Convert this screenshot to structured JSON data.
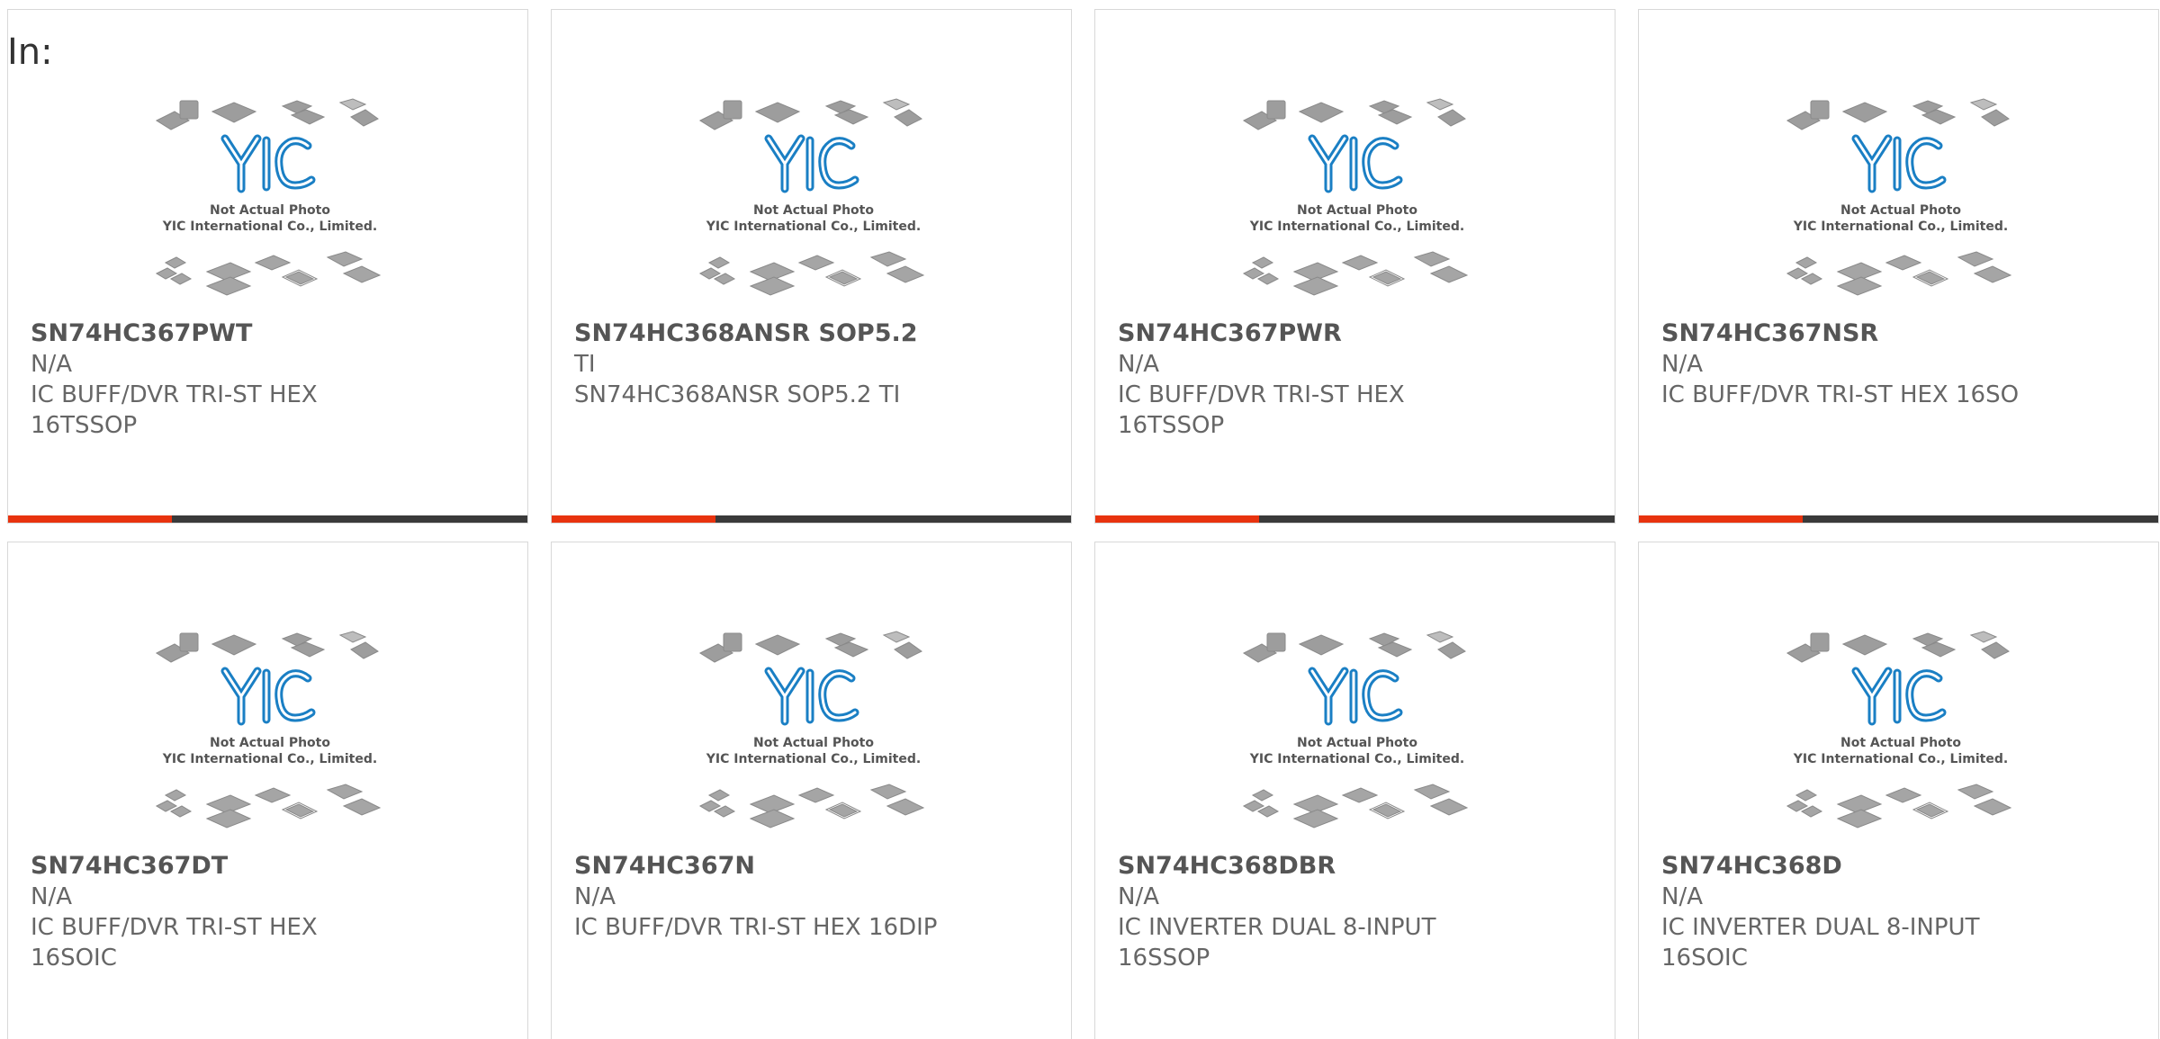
{
  "header": {
    "label": "In:"
  },
  "placeholder": {
    "brand": "YIC",
    "caption_line1": "Not Actual Photo",
    "caption_line2": "YIC International Co., Limited."
  },
  "colors": {
    "accent": "#e8330f",
    "bar": "#3a3a3a",
    "brand_blue": "#1a7fc4"
  },
  "products": [
    {
      "part": "SN74HC367PWT",
      "mfr": "N/A",
      "desc": "IC BUFF/DVR TRI-ST HEX 16TSSOP"
    },
    {
      "part": "SN74HC368ANSR SOP5.2",
      "mfr": "TI",
      "desc": "SN74HC368ANSR SOP5.2 TI"
    },
    {
      "part": "SN74HC367PWR",
      "mfr": "N/A",
      "desc": "IC BUFF/DVR TRI-ST HEX 16TSSOP"
    },
    {
      "part": "SN74HC367NSR",
      "mfr": "N/A",
      "desc": "IC BUFF/DVR TRI-ST HEX 16SO"
    },
    {
      "part": "SN74HC367DT",
      "mfr": "N/A",
      "desc": "IC BUFF/DVR TRI-ST HEX 16SOIC"
    },
    {
      "part": "SN74HC367N",
      "mfr": "N/A",
      "desc": "IC BUFF/DVR TRI-ST HEX 16DIP"
    },
    {
      "part": "SN74HC368DBR",
      "mfr": "N/A",
      "desc": "IC INVERTER DUAL 8-INPUT 16SSOP"
    },
    {
      "part": "SN74HC368D",
      "mfr": "N/A",
      "desc": "IC INVERTER DUAL 8-INPUT 16SOIC"
    }
  ]
}
